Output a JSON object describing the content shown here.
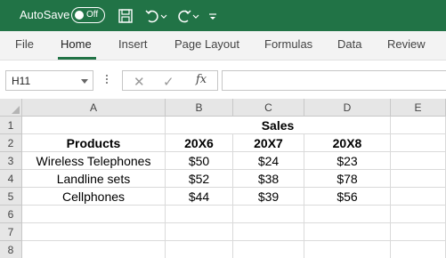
{
  "titlebar": {
    "autosave_label": "AutoSave",
    "autosave_state": "Off",
    "icons": [
      "save-icon",
      "undo-icon",
      "redo-icon",
      "customize-toolbar-icon"
    ],
    "accent": "#217346"
  },
  "tabs": [
    {
      "label": "File"
    },
    {
      "label": "Home",
      "active": true
    },
    {
      "label": "Insert"
    },
    {
      "label": "Page Layout"
    },
    {
      "label": "Formulas"
    },
    {
      "label": "Data"
    },
    {
      "label": "Review"
    }
  ],
  "formula_bar": {
    "name_box": "H11",
    "cancel_symbol": "✕",
    "enter_symbol": "✓",
    "fx_label": "fx",
    "formula": ""
  },
  "sheet": {
    "columns": [
      "A",
      "B",
      "C",
      "D",
      "E"
    ],
    "rows": [
      "1",
      "2",
      "3",
      "4",
      "5",
      "6",
      "7",
      "8"
    ],
    "merged_header": "Sales",
    "header_row": [
      "Products",
      "20X6",
      "20X7",
      "20X8"
    ],
    "data_rows": [
      [
        "Wireless Telephones",
        "$50",
        "$24",
        "$23"
      ],
      [
        "Landline sets",
        "$52",
        "$38",
        "$78"
      ],
      [
        "Cellphones",
        "$44",
        "$39",
        "$56"
      ]
    ]
  }
}
